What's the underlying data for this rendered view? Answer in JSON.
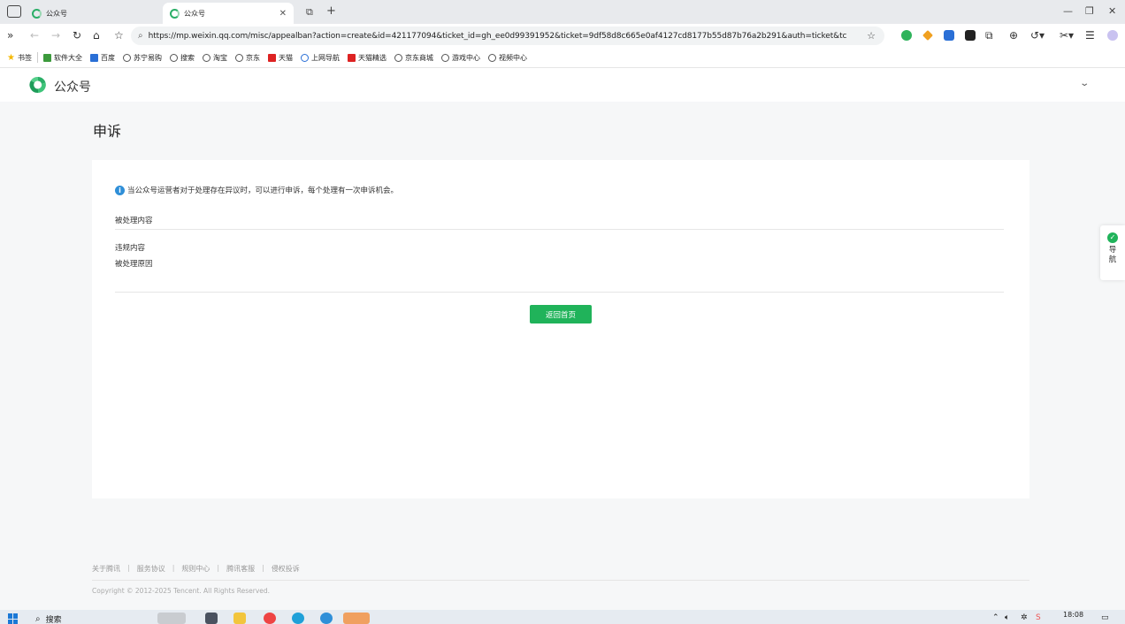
{
  "browser": {
    "tabs": [
      {
        "title": "公众号",
        "active": false
      },
      {
        "title": "公众号",
        "active": true
      }
    ],
    "new_tab": "+",
    "window_controls": {
      "minimize": "—",
      "restore": "❐",
      "close": "✕"
    },
    "url": "https://mp.weixin.qq.com/misc/appealban?action=create&id=421177094&ticket_id=gh_ee0d99391952&ticket=9df58d8c665e0af4127cd8177b55d87b76a2b291&auth=ticket&tc",
    "bookmarks": [
      {
        "label": "书签",
        "icon": "star-icon"
      },
      {
        "label": "软件大全",
        "icon": "download-icon"
      },
      {
        "label": "百度",
        "icon": "baidu-icon"
      },
      {
        "label": "苏宁易购",
        "icon": "globe-icon"
      },
      {
        "label": "搜索",
        "icon": "globe-icon"
      },
      {
        "label": "淘宝",
        "icon": "globe-icon"
      },
      {
        "label": "京东",
        "icon": "globe-icon"
      },
      {
        "label": "天猫",
        "icon": "tmall-icon"
      },
      {
        "label": "上网导航",
        "icon": "q-icon"
      },
      {
        "label": "天猫精选",
        "icon": "tmall-icon"
      },
      {
        "label": "京东商城",
        "icon": "globe-icon"
      },
      {
        "label": "游戏中心",
        "icon": "globe-icon"
      },
      {
        "label": "视频中心",
        "icon": "globe-icon"
      }
    ]
  },
  "header": {
    "logo_text": "公众号"
  },
  "page": {
    "title": "申诉",
    "tip": "当公众号运营者对于处理存在异议时，可以进行申诉，每个处理有一次申诉机会。",
    "section_label": "被处理内容",
    "fields": [
      {
        "label": "违规内容"
      },
      {
        "label": "被处理原因"
      }
    ],
    "back_button": "返回首页"
  },
  "side_nav": {
    "label": "导航"
  },
  "footer": {
    "links": [
      "关于腾讯",
      "服务协议",
      "规则中心",
      "腾讯客服",
      "侵权投诉"
    ],
    "copyright": "Copyright © 2012-2025 Tencent. All Rights Reserved."
  },
  "taskbar": {
    "search_label": "搜索",
    "time": "18:08"
  },
  "colors": {
    "accent": "#20b35a",
    "info": "#2f8fd8",
    "page_bg": "#f6f7f8"
  }
}
